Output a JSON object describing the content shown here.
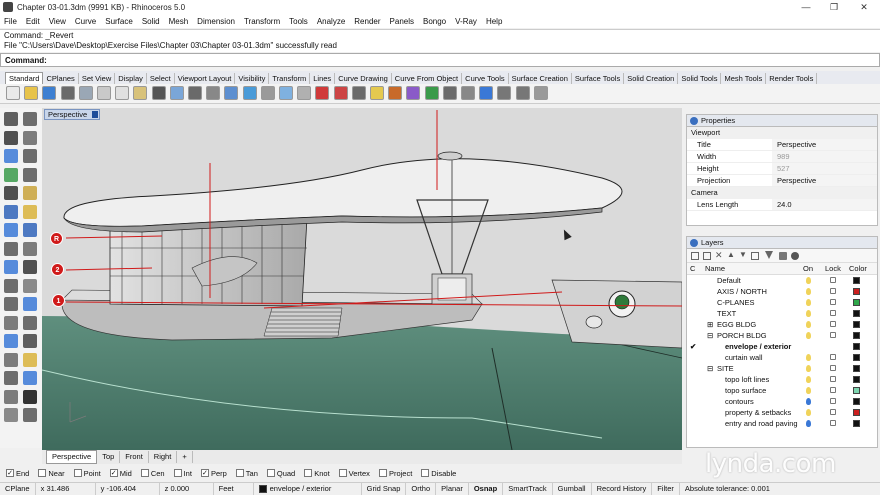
{
  "window": {
    "title": "Chapter 03-01.3dm (9991 KB) - Rhinoceros 5.0",
    "controls": [
      "—",
      "❐",
      "✕"
    ]
  },
  "menu": [
    "File",
    "Edit",
    "View",
    "Curve",
    "Surface",
    "Solid",
    "Mesh",
    "Dimension",
    "Transform",
    "Tools",
    "Analyze",
    "Render",
    "Panels",
    "Bongo",
    "V-Ray",
    "Help"
  ],
  "command_history": [
    "Command: _Revert",
    "File \"C:\\Users\\Dave\\Desktop\\Exercise Files\\Chapter 03\\Chapter 03-01.3dm\" successfully read"
  ],
  "command_prompt": "Command:",
  "toolbar_tabs": [
    "Standard",
    "CPlanes",
    "Set View",
    "Display",
    "Select",
    "Viewport Layout",
    "Visibility",
    "Transform",
    "Lines",
    "Curve Drawing",
    "Curve From Object",
    "Curve Tools",
    "Surface Creation",
    "Surface Tools",
    "Solid Creation",
    "Solid Tools",
    "Mesh Tools",
    "Render Tools"
  ],
  "viewport": {
    "active_label": "Perspective",
    "tabs": [
      "Perspective",
      "Top",
      "Front",
      "Right"
    ],
    "add_tab": "+",
    "markers": [
      "R",
      "2",
      "1"
    ]
  },
  "properties": {
    "tab_label": "Properties",
    "section_viewport": "Viewport",
    "rows": [
      {
        "key": "Title",
        "value": "Perspective",
        "dim": false
      },
      {
        "key": "Width",
        "value": "989",
        "dim": true
      },
      {
        "key": "Height",
        "value": "527",
        "dim": true
      },
      {
        "key": "Projection",
        "value": "Perspective",
        "dim": false
      }
    ],
    "section_camera": "Camera",
    "camera_rows": [
      {
        "key": "Lens Length",
        "value": "24.0"
      }
    ]
  },
  "layers": {
    "tab_label": "Layers",
    "columns": {
      "c": "C",
      "name": "Name",
      "on": "On",
      "lock": "Lock",
      "color": "Color"
    },
    "items": [
      {
        "name": "Default",
        "indent": 0,
        "color": "#111111",
        "bulb": "#f0d35a",
        "current": false,
        "expand": ""
      },
      {
        "name": "AXIS / NORTH",
        "indent": 0,
        "color": "#cc1f1f",
        "bulb": "#f0d35a",
        "current": false,
        "expand": ""
      },
      {
        "name": "C-PLANES",
        "indent": 0,
        "color": "#2fa84a",
        "bulb": "#f0d35a",
        "current": false,
        "expand": ""
      },
      {
        "name": "TEXT",
        "indent": 0,
        "color": "#111111",
        "bulb": "#f0d35a",
        "current": false,
        "expand": ""
      },
      {
        "name": "EGG BLDG",
        "indent": 0,
        "color": "#111111",
        "bulb": "#f0d35a",
        "current": false,
        "expand": "⊞"
      },
      {
        "name": "PORCH BLDG",
        "indent": 0,
        "color": "#111111",
        "bulb": "#f0d35a",
        "current": false,
        "expand": "⊟"
      },
      {
        "name": "envelope / exterior",
        "indent": 1,
        "color": "#111111",
        "bulb": "",
        "current": true,
        "expand": ""
      },
      {
        "name": "curtain wall",
        "indent": 1,
        "color": "#111111",
        "bulb": "#f0d35a",
        "current": false,
        "expand": ""
      },
      {
        "name": "SITE",
        "indent": 0,
        "color": "#111111",
        "bulb": "#f0d35a",
        "current": false,
        "expand": "⊟"
      },
      {
        "name": "topo loft lines",
        "indent": 1,
        "color": "#111111",
        "bulb": "#f0d35a",
        "current": false,
        "expand": ""
      },
      {
        "name": "topo surface",
        "indent": 1,
        "color": "#7ed6b0",
        "bulb": "#f0d35a",
        "current": false,
        "expand": ""
      },
      {
        "name": "contours",
        "indent": 1,
        "color": "#111111",
        "bulb": "#3a78d6",
        "current": false,
        "expand": ""
      },
      {
        "name": "property & setbacks",
        "indent": 1,
        "color": "#cc1f1f",
        "bulb": "#f0d35a",
        "current": false,
        "expand": ""
      },
      {
        "name": "entry and road paving",
        "indent": 1,
        "color": "#111111",
        "bulb": "#3a78d6",
        "current": false,
        "expand": ""
      }
    ],
    "check_mark": "✔"
  },
  "osnap": [
    {
      "label": "End",
      "checked": true
    },
    {
      "label": "Near",
      "checked": false
    },
    {
      "label": "Point",
      "checked": false
    },
    {
      "label": "Mid",
      "checked": true
    },
    {
      "label": "Cen",
      "checked": false
    },
    {
      "label": "Int",
      "checked": false
    },
    {
      "label": "Perp",
      "checked": true
    },
    {
      "label": "Tan",
      "checked": false
    },
    {
      "label": "Quad",
      "checked": false
    },
    {
      "label": "Knot",
      "checked": false
    },
    {
      "label": "Vertex",
      "checked": false
    },
    {
      "label": "Project",
      "checked": false
    },
    {
      "label": "Disable",
      "checked": false
    }
  ],
  "status": {
    "cplane": "CPlane",
    "x": "x 31.486",
    "y": "y -106.404",
    "z": "z 0.000",
    "units": "Feet",
    "layer": "envelope / exterior",
    "toggles": [
      {
        "label": "Grid Snap",
        "on": false
      },
      {
        "label": "Ortho",
        "on": false
      },
      {
        "label": "Planar",
        "on": false
      },
      {
        "label": "Osnap",
        "on": true
      },
      {
        "label": "SmartTrack",
        "on": false
      },
      {
        "label": "Gumball",
        "on": false
      },
      {
        "label": "Record History",
        "on": false
      },
      {
        "label": "Filter",
        "on": false
      }
    ],
    "tolerance": "Absolute tolerance: 0.001"
  },
  "watermark": "lynda.com",
  "colors": {
    "ground": "#4f7f6f",
    "sky": "#d9d9d9",
    "accent_red": "#d01a1a",
    "building": "#c8c8c8"
  }
}
